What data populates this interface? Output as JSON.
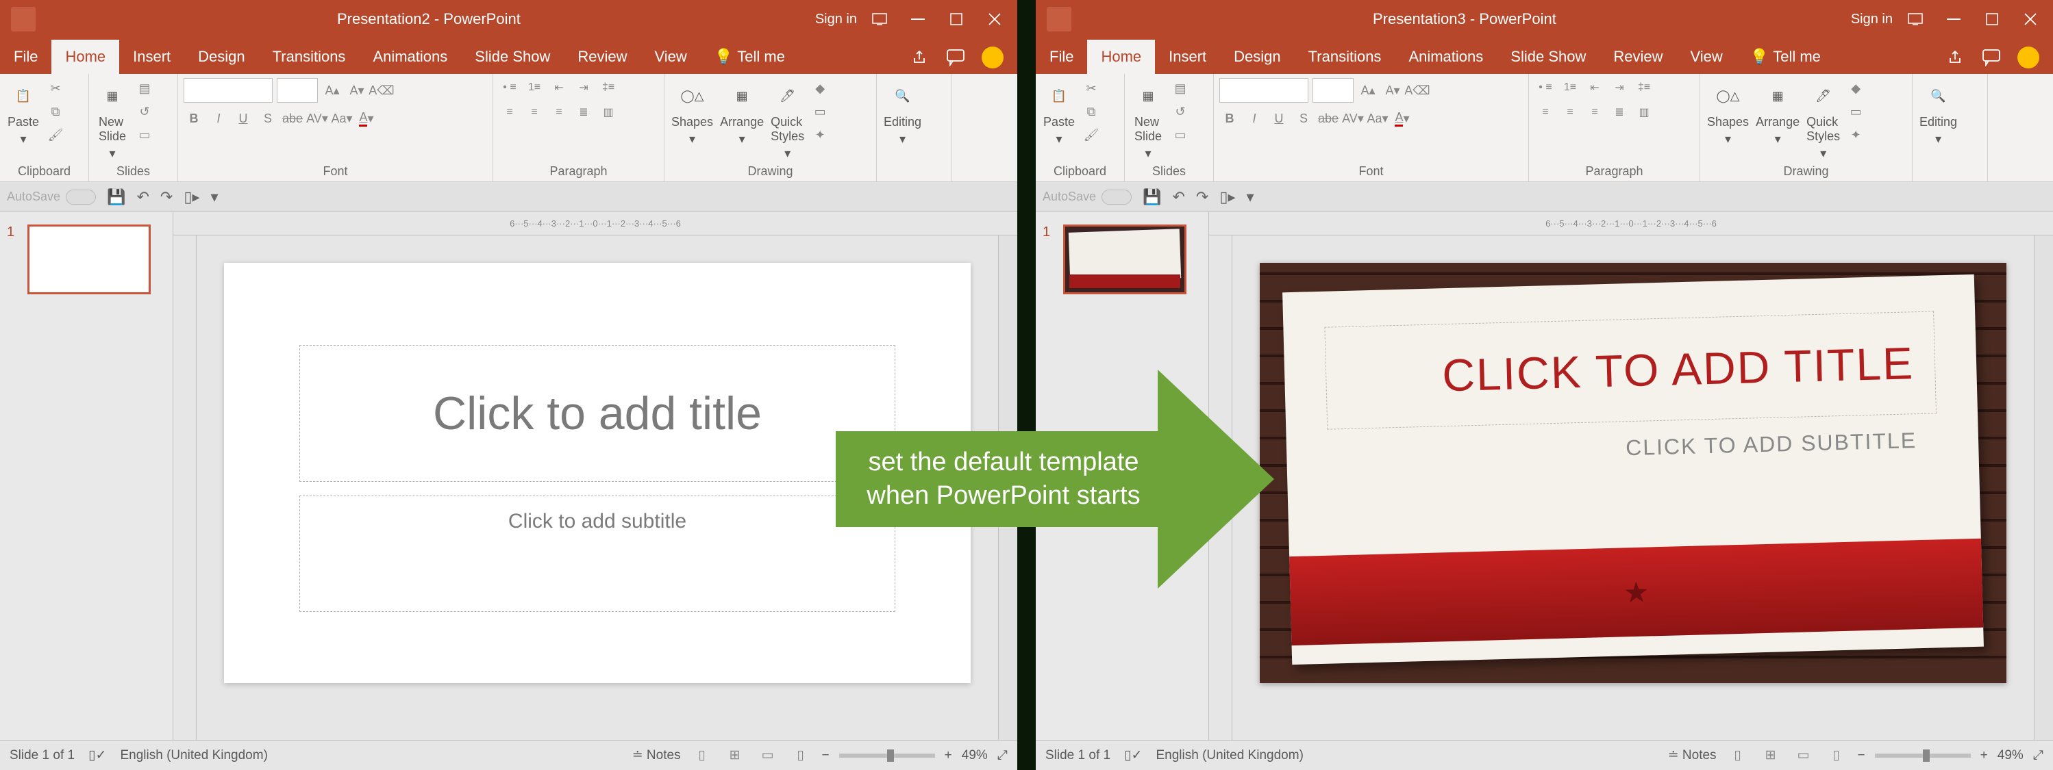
{
  "left": {
    "title": "Presentation2  -  PowerPoint",
    "sign_in": "Sign in",
    "tabs": {
      "file": "File",
      "home": "Home",
      "insert": "Insert",
      "design": "Design",
      "transitions": "Transitions",
      "animations": "Animations",
      "slideshow": "Slide Show",
      "review": "Review",
      "view": "View",
      "tellme": "Tell me"
    },
    "ribbon": {
      "clipboard": {
        "label": "Clipboard",
        "paste": "Paste"
      },
      "slides": {
        "label": "Slides",
        "newslide": "New\nSlide"
      },
      "font": {
        "label": "Font",
        "bold": "B",
        "italic": "I",
        "underline": "U",
        "strike": "S",
        "shadow": "abe"
      },
      "paragraph": {
        "label": "Paragraph"
      },
      "drawing": {
        "label": "Drawing",
        "shapes": "Shapes",
        "arrange": "Arrange",
        "quick": "Quick\nStyles"
      },
      "editing": {
        "label": "Editing"
      }
    },
    "autosave": "AutoSave",
    "thumb_num": "1",
    "slide": {
      "title": "Click to add title",
      "subtitle": "Click to add subtitle"
    },
    "status": {
      "slide": "Slide 1 of 1",
      "lang": "English (United Kingdom)",
      "notes": "Notes",
      "zoom": "49%"
    },
    "ruler_ticks": "6···5···4···3···2···1···0···1···2···3···4···5···6"
  },
  "right": {
    "title": "Presentation3  -  PowerPoint",
    "sign_in": "Sign in",
    "tabs": {
      "file": "File",
      "home": "Home",
      "insert": "Insert",
      "design": "Design",
      "transitions": "Transitions",
      "animations": "Animations",
      "slideshow": "Slide Show",
      "review": "Review",
      "view": "View",
      "tellme": "Tell me"
    },
    "ribbon": {
      "clipboard": {
        "label": "Clipboard",
        "paste": "Paste"
      },
      "slides": {
        "label": "Slides",
        "newslide": "New\nSlide"
      },
      "font": {
        "label": "Font",
        "bold": "B",
        "italic": "I",
        "underline": "U",
        "strike": "S",
        "shadow": "abe"
      },
      "paragraph": {
        "label": "Paragraph"
      },
      "drawing": {
        "label": "Drawing",
        "shapes": "Shapes",
        "arrange": "Arrange",
        "quick": "Quick\nStyles"
      },
      "editing": {
        "label": "Editing"
      }
    },
    "autosave": "AutoSave",
    "thumb_num": "1",
    "slide": {
      "title": "CLICK TO ADD TITLE",
      "subtitle": "CLICK TO ADD SUBTITLE"
    },
    "status": {
      "slide": "Slide 1 of 1",
      "lang": "English (United Kingdom)",
      "notes": "Notes",
      "zoom": "49%"
    },
    "ruler_ticks": "6···5···4···3···2···1···0···1···2···3···4···5···6"
  },
  "arrow": {
    "line1": "set the default template",
    "line2": "when PowerPoint starts"
  }
}
